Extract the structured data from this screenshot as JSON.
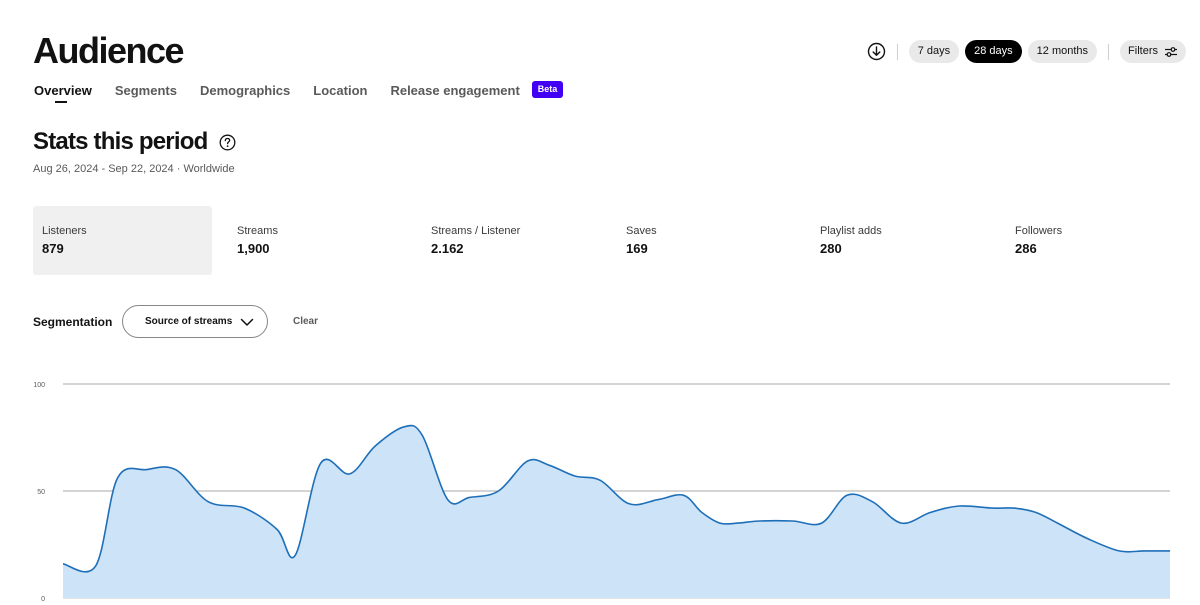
{
  "header": {
    "title": "Audience"
  },
  "tabs": [
    {
      "label": "Overview",
      "active": true
    },
    {
      "label": "Segments",
      "active": false
    },
    {
      "label": "Demographics",
      "active": false
    },
    {
      "label": "Location",
      "active": false
    },
    {
      "label": "Release engagement",
      "active": false,
      "badge": "Beta"
    }
  ],
  "toolbar": {
    "download_icon": "download-circle-icon",
    "ranges": [
      {
        "label": "7 days",
        "active": false
      },
      {
        "label": "28 days",
        "active": true
      },
      {
        "label": "12 months",
        "active": false
      }
    ],
    "filters_label": "Filters",
    "filters_icon": "sliders-icon"
  },
  "stats_section": {
    "title": "Stats this period",
    "help_icon": "question-circle-icon",
    "date_range": "Aug 26, 2024 - Sep 22, 2024 · Worldwide",
    "metrics": [
      {
        "label": "Listeners",
        "value": "879",
        "active": true
      },
      {
        "label": "Streams",
        "value": "1,900",
        "active": false
      },
      {
        "label": "Streams / Listener",
        "value": "2.162",
        "active": false
      },
      {
        "label": "Saves",
        "value": "169",
        "active": false
      },
      {
        "label": "Playlist adds",
        "value": "280",
        "active": false
      },
      {
        "label": "Followers",
        "value": "286",
        "active": false
      }
    ]
  },
  "segmentation": {
    "label": "Segmentation",
    "selected": "Source of streams",
    "clear_label": "Clear"
  },
  "colors": {
    "accent_black": "#000000",
    "beta_badge": "#4100f4",
    "line": "#1e6fb8",
    "area_fill": "#cde3f8",
    "pill_bg": "#e9e9e9"
  },
  "chart_data": {
    "type": "area",
    "title": "",
    "xlabel": "",
    "ylabel": "",
    "ylim": [
      0,
      100
    ],
    "yticks": [
      "0",
      "50",
      "100"
    ],
    "grid": true,
    "x": [
      0,
      0.9,
      1.5,
      2.3,
      3.1,
      4,
      5,
      5.9,
      6.4,
      7.1,
      7.9,
      8.6,
      9.4,
      9.9,
      10.6,
      11.2,
      12,
      12.8,
      13.4,
      14.1,
      14.8,
      15.6,
      16.4,
      17.1,
      17.6,
      18.1,
      18.6,
      19.2,
      20.1,
      20.9,
      21.6,
      22.3,
      23.1,
      23.9,
      24.7,
      25.6,
      26.2,
      26.8,
      27.4,
      28.2,
      29.1,
      29.8,
      30.5
    ],
    "series": [
      {
        "values": [
          16,
          15,
          56,
          60,
          60,
          45,
          42,
          32,
          20,
          63,
          58,
          71,
          80,
          76,
          46,
          47,
          50,
          64,
          62,
          57,
          55,
          44,
          46,
          48,
          40,
          35,
          35,
          36,
          36,
          35,
          48,
          45,
          35,
          40,
          43,
          42,
          42,
          40,
          35,
          28,
          22,
          22,
          22
        ]
      }
    ]
  }
}
